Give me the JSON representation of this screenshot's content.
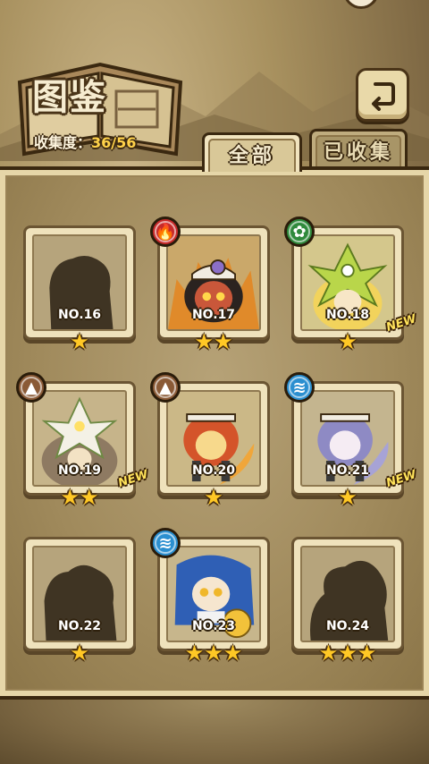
{
  "header": {
    "title": "图鉴",
    "collect_label": "收集度：",
    "collect_count": "36/56"
  },
  "tabs": [
    {
      "label": "全部",
      "active": true
    },
    {
      "label": "已收集",
      "active": false
    }
  ],
  "cards": [
    {
      "no": "NO.16",
      "stars": "★",
      "element": "",
      "new": "",
      "locked": true
    },
    {
      "no": "NO.17",
      "stars": "★★",
      "element": "fire",
      "new": "",
      "locked": false
    },
    {
      "no": "NO.18",
      "stars": "★",
      "element": "leaf",
      "new": "NEW",
      "locked": false
    },
    {
      "no": "NO.19",
      "stars": "★★",
      "element": "earth",
      "new": "NEW",
      "locked": false
    },
    {
      "no": "NO.20",
      "stars": "★",
      "element": "earth",
      "new": "",
      "locked": false
    },
    {
      "no": "NO.21",
      "stars": "★",
      "element": "water",
      "new": "NEW",
      "locked": false
    },
    {
      "no": "NO.22",
      "stars": "★",
      "element": "",
      "new": "",
      "locked": true
    },
    {
      "no": "NO.23",
      "stars": "★★★",
      "element": "water",
      "new": "",
      "locked": false
    },
    {
      "no": "NO.24",
      "stars": "★★★",
      "element": "",
      "new": "",
      "locked": true
    }
  ],
  "colors": {
    "fire": "#c72a2a",
    "leaf": "#2f8a3c",
    "earth": "#8a5a36",
    "water": "#2b8fd0",
    "star": "#ffc825",
    "count": "#ffd24a"
  }
}
